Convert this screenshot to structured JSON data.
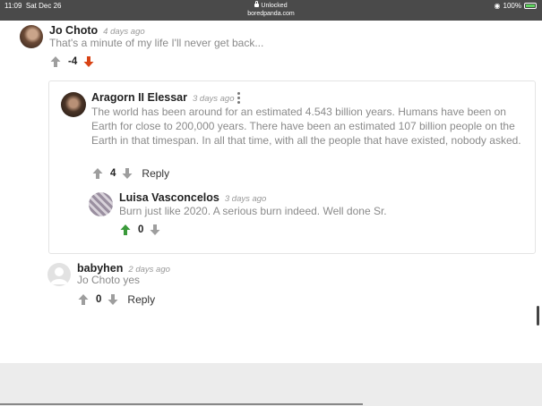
{
  "status_bar": {
    "time": "11:09",
    "date": "Sat Dec 26",
    "lock_status": "Unlocked",
    "url": "boredpanda.com",
    "battery": "100%"
  },
  "comments": [
    {
      "author": "Jo Choto",
      "date": "4 days ago",
      "text": "That's a minute of my life I'll never get back...",
      "votes": "-4"
    },
    {
      "author": "Aragorn II Elessar",
      "date": "3 days ago",
      "text": "The world has been around for an estimated 4.543 billion years. Humans have been on Earth for close to 200,000 years. There have been an estimated 107 billion people on the Earth in that timespan. In all that time, with all the people that have existed, nobody asked.",
      "votes": "4",
      "reply": "Reply"
    },
    {
      "author": "Luisa Vasconcelos",
      "date": "3 days ago",
      "text": "Burn just like 2020. A serious burn indeed. Well done Sr.",
      "votes": "0"
    },
    {
      "author": "babyhen",
      "date": "2 days ago",
      "text": "Jo Choto yes",
      "votes": "0",
      "reply": "Reply"
    }
  ],
  "colors": {
    "upvote_active": "#3a9a3a",
    "downvote_active": "#d84315",
    "arrow_inactive": "#9e9e9e"
  }
}
